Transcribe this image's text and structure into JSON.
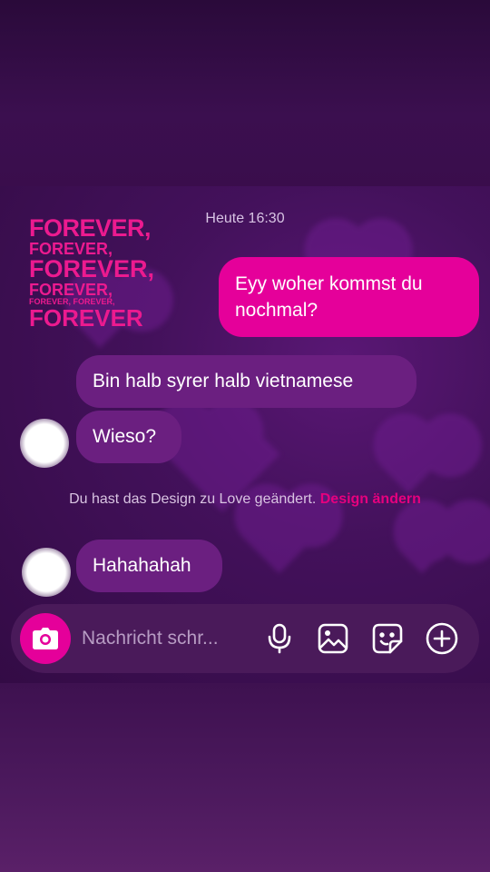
{
  "chat": {
    "sticker_lines": [
      "FOREVER,",
      "FOREVER,",
      "FOREVER,",
      "FOREVER,",
      "FOREVER, FOREVER,",
      "FOREVER"
    ],
    "timestamp": "Heute 16:30",
    "messages": [
      {
        "direction": "outgoing",
        "text": "Eyy woher kommst du nochmal?"
      },
      {
        "direction": "incoming",
        "text": "Bin halb syrer halb vietnamese"
      },
      {
        "direction": "incoming",
        "text": "Wieso?"
      },
      {
        "direction": "incoming",
        "text": "Hahahahah"
      }
    ],
    "theme_notice": {
      "text": "Du hast das Design zu Love geändert.",
      "link": "Design ändern"
    }
  },
  "composer": {
    "placeholder": "Nachricht schr...",
    "icons": [
      "camera-icon",
      "microphone-icon",
      "gallery-icon",
      "sticker-icon",
      "add-icon"
    ]
  },
  "colors": {
    "accent": "#e5009a",
    "incoming_bubble": "#6b1f80",
    "background": "#3a0f4c"
  }
}
